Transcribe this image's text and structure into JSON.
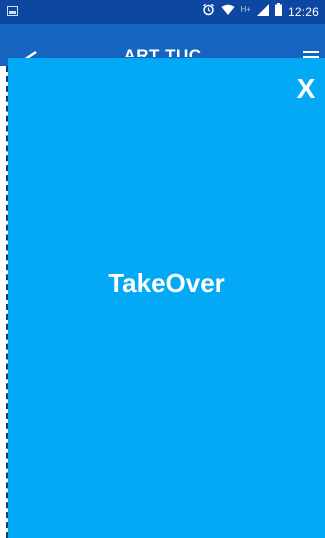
{
  "status_bar": {
    "time": "12:26",
    "network_label": "H+",
    "icons": [
      "image-icon",
      "alarm-icon",
      "wifi-icon",
      "signal-icon",
      "battery-icon"
    ]
  },
  "app_bar": {
    "title": "ART TUC",
    "icons": [
      "back-arrow-icon",
      "menu-icon"
    ]
  },
  "takeover": {
    "title": "TakeOver",
    "close_label": "X",
    "background_color": "#03a9f4"
  },
  "colors": {
    "status_bar": "#0d47a1",
    "app_bar": "#1565c0"
  }
}
